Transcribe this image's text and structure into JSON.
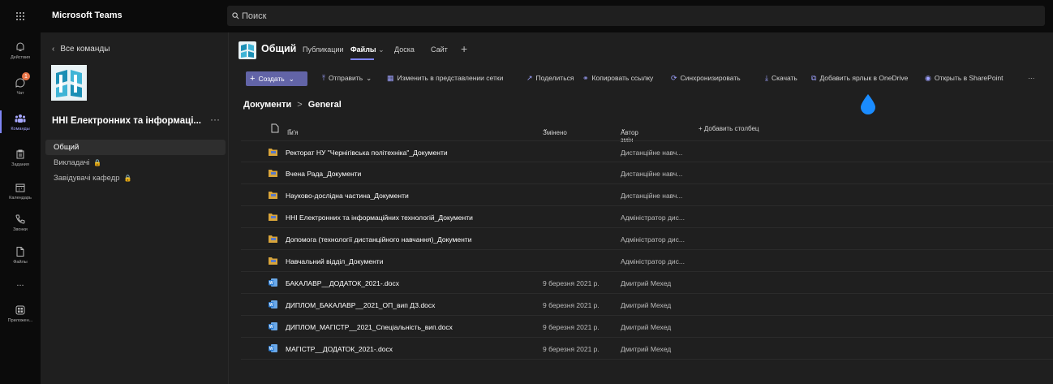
{
  "app": {
    "title": "Microsoft Teams"
  },
  "search": {
    "placeholder": "Поиск"
  },
  "rail": [
    {
      "label": "Действия",
      "icon": "bell-icon"
    },
    {
      "label": "Чат",
      "icon": "chat-icon",
      "badge": "1"
    },
    {
      "label": "Команды",
      "icon": "teams-icon",
      "active": true
    },
    {
      "label": "Задания",
      "icon": "assignments-icon"
    },
    {
      "label": "Календарь",
      "icon": "calendar-icon"
    },
    {
      "label": "Звонки",
      "icon": "phone-icon"
    },
    {
      "label": "Файлы",
      "icon": "file-icon"
    },
    {
      "label": "...",
      "icon": "more-icon"
    },
    {
      "label": "Приложен...",
      "icon": "apps-icon"
    }
  ],
  "teampane": {
    "back": "Все команды",
    "team_name": "ННІ Електронних та інформаці...",
    "more": "···",
    "channels": [
      {
        "label": "Общий",
        "active": true
      },
      {
        "label": "Викладачі",
        "locked": true
      },
      {
        "label": "Завідувачі кафедр",
        "locked": true
      }
    ]
  },
  "channel": {
    "title": "Общий",
    "tabs": [
      "Публикации",
      "Файлы",
      "Доска",
      "Сайт"
    ],
    "plus": "+"
  },
  "commands": {
    "create": "Создать",
    "items": [
      "Отправить",
      "Изменить в представлении сетки",
      "Поделиться",
      "Копировать ссылку",
      "Синхронизировать",
      "Скачать",
      "Добавить ярлык в OneDrive",
      "Открыть в SharePoint"
    ],
    "more": "···"
  },
  "breadcrumb": {
    "root": "Документи",
    "sep": ">",
    "current": "General"
  },
  "table": {
    "headers": {
      "name": "Ім'я",
      "modified": "Змінено",
      "author": "Автор змін",
      "add": "+ Добавить столбец"
    },
    "rows": [
      {
        "type": "folder",
        "name": "Ректорат НУ \"Чернігівська політехніка\"_Документи",
        "modified": "",
        "author": "Дистанційне навч..."
      },
      {
        "type": "folder",
        "name": "Вчена Рада_Документи",
        "modified": "",
        "author": "Дистанційне навч..."
      },
      {
        "type": "folder",
        "name": "Науково-дослідна частина_Документи",
        "modified": "",
        "author": "Дистанційне навч..."
      },
      {
        "type": "folder",
        "name": "ННІ Електронних та інформаційних технологій_Документи",
        "modified": "",
        "author": "Адміністратор дис..."
      },
      {
        "type": "folder",
        "name": "Допомога (технології дистанційного навчання)_Документи",
        "modified": "",
        "author": "Адміністратор дис..."
      },
      {
        "type": "folder",
        "name": "Навчальний відділ_Документи",
        "modified": "",
        "author": "Адміністратор дис..."
      },
      {
        "type": "docx",
        "name": "БАКАЛАВР__ДОДАТОК_2021-.docx",
        "modified": "9 березня 2021 р.",
        "author": "Дмитрий Мехед"
      },
      {
        "type": "docx",
        "name": "ДИПЛОМ_БАКАЛАВР__2021_ОП_вип ДЗ.docx",
        "modified": "9 березня 2021 р.",
        "author": "Дмитрий Мехед"
      },
      {
        "type": "docx",
        "name": "ДИПЛОМ_МАГІСТР__2021_Спеціальність_вип.docx",
        "modified": "9 березня 2021 р.",
        "author": "Дмитрий Мехед"
      },
      {
        "type": "docx",
        "name": "МАГІСТР__ДОДАТОК_2021-.docx",
        "modified": "9 березня 2021 р.",
        "author": "Дмитрий Мехед"
      }
    ]
  },
  "colors": {
    "accent": "#6264a7",
    "accent_light": "#7f85f5",
    "folder": "#d9a53a",
    "word": "#2b7cd3",
    "drop": "#1a8cff"
  }
}
